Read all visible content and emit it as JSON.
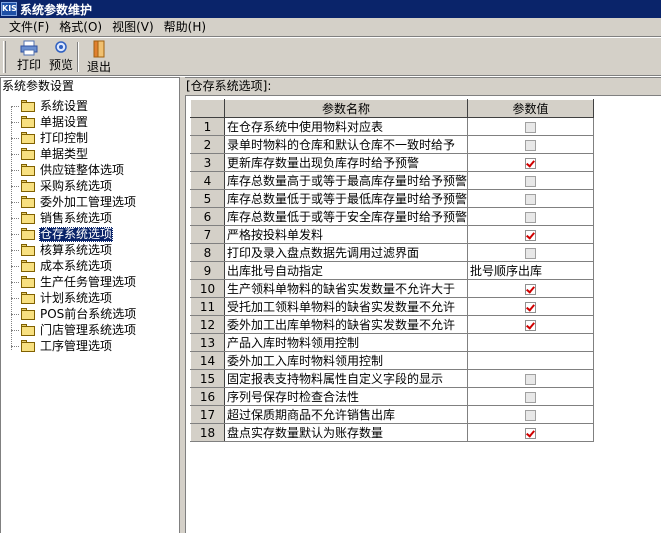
{
  "app": {
    "icon_text": "KIS",
    "title": "系统参数维护"
  },
  "menu": {
    "items": [
      "文件(F)",
      "格式(O)",
      "视图(V)",
      "帮助(H)"
    ]
  },
  "toolbar": {
    "print_label": "打印",
    "preview_label": "预览",
    "exit_label": "退出"
  },
  "left_panel": {
    "header": "系统参数设置",
    "items": [
      {
        "label": "系统设置"
      },
      {
        "label": "单据设置"
      },
      {
        "label": "打印控制"
      },
      {
        "label": "单据类型"
      },
      {
        "label": "供应链整体选项"
      },
      {
        "label": "采购系统选项"
      },
      {
        "label": "委外加工管理选项"
      },
      {
        "label": "销售系统选项"
      },
      {
        "label": "仓存系统选项"
      },
      {
        "label": "核算系统选项"
      },
      {
        "label": "成本系统选项"
      },
      {
        "label": "生产任务管理选项"
      },
      {
        "label": "计划系统选项"
      },
      {
        "label": "POS前台系统选项"
      },
      {
        "label": "门店管理系统选项"
      },
      {
        "label": "工序管理选项"
      }
    ],
    "selected_index": 8
  },
  "right_panel": {
    "header": "[仓存系统选项]:",
    "columns": {
      "name": "参数名称",
      "value": "参数值"
    },
    "rows": [
      {
        "num": "1",
        "name": "在仓存系统中使用物料对应表",
        "type": "check",
        "checked": false
      },
      {
        "num": "2",
        "name": "录单时物料的仓库和默认仓库不一致时给予",
        "type": "check",
        "checked": false
      },
      {
        "num": "3",
        "name": "更新库存数量出现负库存时给予预警",
        "type": "check",
        "checked": true
      },
      {
        "num": "4",
        "name": "库存总数量高于或等于最高库存量时给予预警",
        "type": "check",
        "checked": false
      },
      {
        "num": "5",
        "name": "库存总数量低于或等于最低库存量时给予预警",
        "type": "check",
        "checked": false
      },
      {
        "num": "6",
        "name": "库存总数量低于或等于安全库存量时给予预警",
        "type": "check",
        "checked": false
      },
      {
        "num": "7",
        "name": "严格按投料单发料",
        "type": "check",
        "checked": true
      },
      {
        "num": "8",
        "name": "打印及录入盘点数据先调用过滤界面",
        "type": "check",
        "checked": false
      },
      {
        "num": "9",
        "name": "出库批号自动指定",
        "type": "text",
        "value": "批号顺序出库"
      },
      {
        "num": "10",
        "name": "生产领料单物料的缺省实发数量不允许大于",
        "type": "check",
        "checked": true
      },
      {
        "num": "11",
        "name": "受托加工领料单物料的缺省实发数量不允许",
        "type": "check",
        "checked": true
      },
      {
        "num": "12",
        "name": "委外加工出库单物料的缺省实发数量不允许",
        "type": "check",
        "checked": true
      },
      {
        "num": "13",
        "name": "产品入库时物料领用控制",
        "type": "text",
        "value": ""
      },
      {
        "num": "14",
        "name": "委外加工入库时物料领用控制",
        "type": "text",
        "value": ""
      },
      {
        "num": "15",
        "name": "固定报表支持物料属性自定义字段的显示",
        "type": "check",
        "checked": false
      },
      {
        "num": "16",
        "name": "序列号保存时检查合法性",
        "type": "check",
        "checked": false
      },
      {
        "num": "17",
        "name": "超过保质期商品不允许销售出库",
        "type": "check",
        "checked": false
      },
      {
        "num": "18",
        "name": "盘点实存数量默认为账存数量",
        "type": "check",
        "checked": true
      }
    ]
  },
  "colors": {
    "title_bg": "#0a246a",
    "selection_bg": "#0a246a",
    "check_mark": "#d00000",
    "face": "#d4d0c8"
  }
}
